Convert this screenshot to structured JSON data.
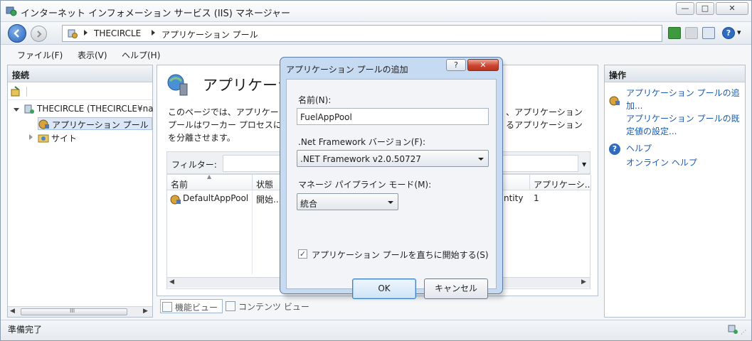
{
  "window": {
    "title": "インターネット インフォメーション サービス (IIS) マネージャー",
    "controls": {
      "minimize": "—",
      "maximize": "□",
      "close": "✕"
    }
  },
  "nav": {
    "breadcrumb": [
      "THECIRCLE",
      "アプリケーション プール"
    ],
    "help_glyph": "?",
    "help_dropdown_glyph": "▾"
  },
  "menu": {
    "file": "ファイル(F)",
    "view": "表示(V)",
    "help": "ヘルプ(H)"
  },
  "connections": {
    "header": "接続",
    "server_node": "THECIRCLE (THECIRCLE¥na",
    "app_pools_node": "アプリケーション プール",
    "sites_node": "サイト",
    "scroll_glyph": "III"
  },
  "center": {
    "title": "アプリケーシ",
    "desc_lines_left": [
      "このページでは、アプリケー",
      "プールはワーカー プロセスに",
      "を分離させます。"
    ],
    "desc_lines_right": [
      "、アプリケーション",
      "るアプリケーション"
    ],
    "filter_label": "フィルター:",
    "columns": [
      "名前",
      "状態",
      "アプリケーシ..."
    ],
    "row": {
      "name": "DefaultAppPool",
      "status": "開始...",
      "identity_partial": "ntity",
      "apps": "1"
    },
    "views": {
      "features": "機能ビュー",
      "content": "コンテンツ ビュー"
    }
  },
  "actions": {
    "header": "操作",
    "add_pool_lines": [
      "アプリケーション プールの追",
      "加..."
    ],
    "defaults_lines": [
      "アプリケーション プールの既",
      "定値の設定..."
    ],
    "help": "ヘルプ",
    "online_help": "オンライン ヘルプ"
  },
  "dialog": {
    "title": "アプリケーション プールの追加",
    "help_glyph": "?",
    "close_glyph": "✕",
    "name_label": "名前(N):",
    "name_value": "FuelAppPool",
    "framework_label": ".Net Framework バージョン(F):",
    "framework_value": ".NET Framework v2.0.50727",
    "pipeline_label": "マネージ パイプライン モード(M):",
    "pipeline_value": "統合",
    "start_checkbox_label": "アプリケーション プールを直ちに開始する(S)",
    "start_checked": "✓",
    "ok": "OK",
    "cancel": "キャンセル"
  },
  "status": {
    "text": "準備完了"
  },
  "colors": {
    "accent": "#1a5bb0",
    "dialog_frame": "#c6daf2",
    "close_red": "#cc4630"
  }
}
